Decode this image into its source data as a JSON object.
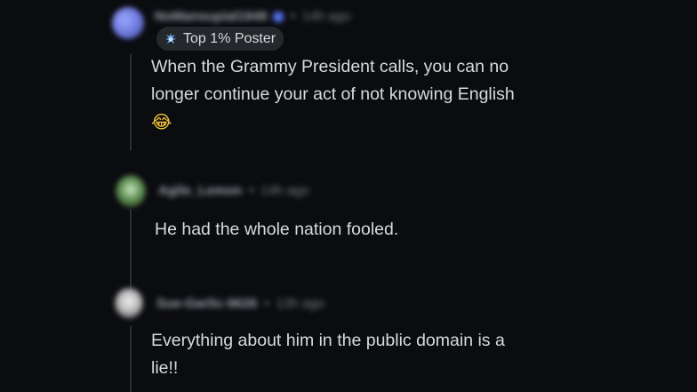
{
  "comments": [
    {
      "username": "NoMansupial1948",
      "age": "14h ago",
      "badge": "Top 1% Poster",
      "text_line1": "When the Grammy President calls, you can no",
      "text_line2": "longer continue your act of not knowing English",
      "emoji": "😂"
    },
    {
      "username": "Agile_Lemon",
      "age": "14h ago",
      "text_line1": "He had the whole nation fooled."
    },
    {
      "username": "Sue-Garlic-9626",
      "age": "13h ago",
      "text_line1": "Everything about him in the public domain is a",
      "text_line2": "lie!!"
    }
  ],
  "icons": {
    "badge_icon": "sparkle-flame-icon"
  },
  "colors": {
    "background": "#0b0c10",
    "text": "#d7dadc",
    "badge_bg": "#24272b",
    "thread_line": "#2a2d31"
  }
}
